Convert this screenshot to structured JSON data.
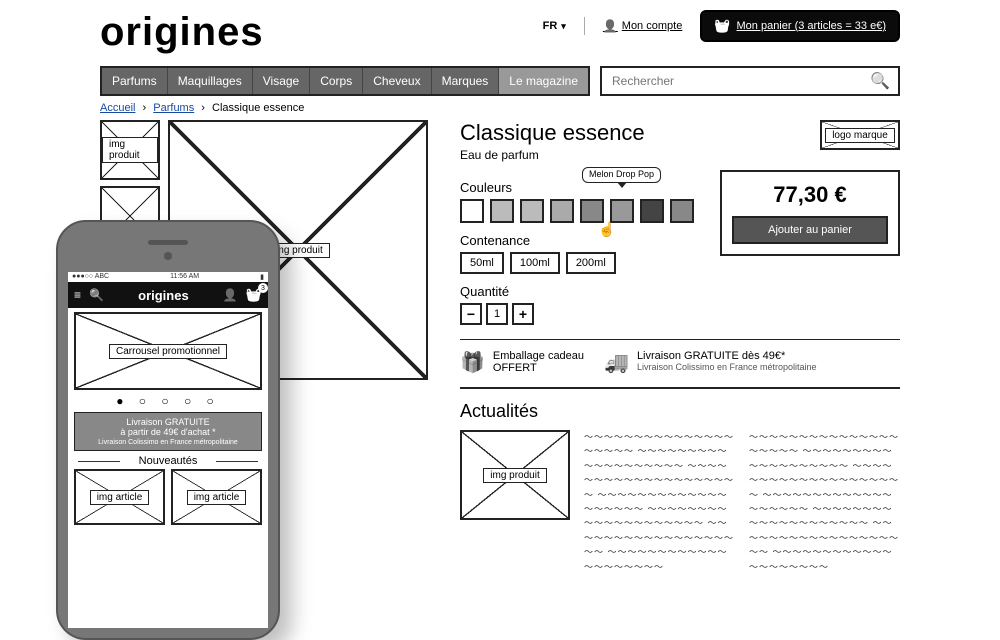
{
  "header": {
    "logo": "origines",
    "lang": "FR",
    "account": "Mon compte",
    "cart": "Mon panier (3 articles = 33 e€)"
  },
  "nav": {
    "items": [
      "Parfums",
      "Maquillages",
      "Visage",
      "Corps",
      "Cheveux",
      "Marques",
      "Le magazine"
    ],
    "active_index": 6
  },
  "search": {
    "placeholder": "Rechercher"
  },
  "crumbs": {
    "home": "Accueil",
    "cat": "Parfums",
    "current": "Classique essence"
  },
  "gallery": {
    "thumb": "img produit",
    "main": "img produit"
  },
  "product": {
    "title": "Classique essence",
    "subtitle": "Eau de parfum",
    "brand_ph": "logo marque",
    "color_label": "Couleurs",
    "color_tooltip": "Melon\nDrop Pop",
    "swatch_fills": [
      "#fff",
      "#bbb",
      "#bbb",
      "#aaa",
      "#888",
      "#999",
      "#444",
      "#888"
    ],
    "size_label": "Contenance",
    "sizes": [
      "50ml",
      "100ml",
      "200ml"
    ],
    "qty_label": "Quantité",
    "qty": "1",
    "price": "77,30 €",
    "add": "Ajouter au panier"
  },
  "benefits": {
    "gift": {
      "t": "Emballage cadeau",
      "s": "OFFERT"
    },
    "ship": {
      "t": "Livraison GRATUITE dès 49€*",
      "s": "Livraison Colissimo en France métropolitaine"
    }
  },
  "news": {
    "title": "Actualités",
    "ph": "img produit"
  },
  "phone": {
    "status": {
      "carrier": "●●●○○ ABC",
      "time": "11:56 AM",
      "batt": "▮"
    },
    "logo": "origines",
    "cart_count": "3",
    "carousel": "Carrousel promotionnel",
    "ship1": "Livraison GRATUITE",
    "ship2": "à partir de 49€ d'achat *",
    "ship3": "Livraison Colissimo en France métropolitaine",
    "nouv": "Nouveautés",
    "article": "img article"
  }
}
